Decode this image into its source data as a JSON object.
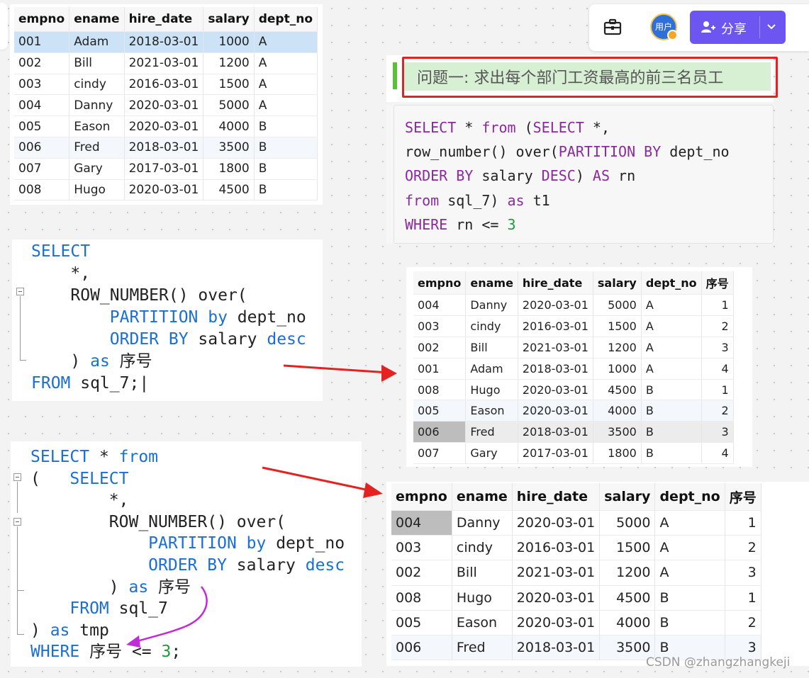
{
  "columns_base": [
    "empno",
    "ename",
    "hire_date",
    "salary",
    "dept_no"
  ],
  "columns_ranked": [
    "empno",
    "ename",
    "hire_date",
    "salary",
    "dept_no",
    "序号"
  ],
  "source_table": {
    "rows": [
      [
        "001",
        "Adam",
        "2018-03-01",
        "1000",
        "A"
      ],
      [
        "002",
        "Bill",
        "2021-03-01",
        "1200",
        "A"
      ],
      [
        "003",
        "cindy",
        "2016-03-01",
        "1500",
        "A"
      ],
      [
        "004",
        "Danny",
        "2020-03-01",
        "5000",
        "A"
      ],
      [
        "005",
        "Eason",
        "2020-03-01",
        "4000",
        "B"
      ],
      [
        "006",
        "Fred",
        "2018-03-01",
        "3500",
        "B"
      ],
      [
        "007",
        "Gary",
        "2017-03-01",
        "1800",
        "B"
      ],
      [
        "008",
        "Hugo",
        "2020-03-01",
        "4500",
        "B"
      ]
    ]
  },
  "ranked_table": {
    "rows": [
      [
        "004",
        "Danny",
        "2020-03-01",
        "5000",
        "A",
        "1"
      ],
      [
        "003",
        "cindy",
        "2016-03-01",
        "1500",
        "A",
        "2"
      ],
      [
        "002",
        "Bill",
        "2021-03-01",
        "1200",
        "A",
        "3"
      ],
      [
        "001",
        "Adam",
        "2018-03-01",
        "1000",
        "A",
        "4"
      ],
      [
        "008",
        "Hugo",
        "2020-03-01",
        "4500",
        "B",
        "1"
      ],
      [
        "005",
        "Eason",
        "2020-03-01",
        "4000",
        "B",
        "2"
      ],
      [
        "006",
        "Fred",
        "2018-03-01",
        "3500",
        "B",
        "3"
      ],
      [
        "007",
        "Gary",
        "2017-03-01",
        "1800",
        "B",
        "4"
      ]
    ]
  },
  "top3_table": {
    "rows": [
      [
        "004",
        "Danny",
        "2020-03-01",
        "5000",
        "A",
        "1"
      ],
      [
        "003",
        "cindy",
        "2016-03-01",
        "1500",
        "A",
        "2"
      ],
      [
        "002",
        "Bill",
        "2021-03-01",
        "1200",
        "A",
        "3"
      ],
      [
        "008",
        "Hugo",
        "2020-03-01",
        "4500",
        "B",
        "1"
      ],
      [
        "005",
        "Eason",
        "2020-03-01",
        "4000",
        "B",
        "2"
      ],
      [
        "006",
        "Fred",
        "2018-03-01",
        "3500",
        "B",
        "3"
      ]
    ]
  },
  "question": {
    "title": "问题一: 求出每个部门工资最高的前三名员工",
    "sql": {
      "l1_a": "SELECT",
      "l1_b": " * ",
      "l1_c": "from",
      "l1_d": " (",
      "l1_e": "SELECT",
      "l1_f": " *,",
      "l2_a": "row_number() over(",
      "l2_b": "PARTITION BY",
      "l2_c": " dept_no",
      "l3_a": "ORDER BY",
      "l3_b": " salary ",
      "l3_c": "DESC",
      "l3_d": ") ",
      "l3_e": "AS",
      "l3_f": " rn",
      "l4_a": "from",
      "l4_b": " sql_7) ",
      "l4_c": "as",
      "l4_d": " t1",
      "l5_a": "WHERE",
      "l5_b": " rn <= ",
      "l5_c": "3"
    }
  },
  "snippet1": {
    "select": "SELECT",
    "star": "*,",
    "rownum": "ROW_NUMBER() over(",
    "partition": "PARTITION by",
    "partition_col": " dept_no",
    "order": "ORDER BY",
    "order_col": " salary ",
    "desc": "desc",
    "close": ") ",
    "as": "as",
    "alias": " 序号",
    "from": "FROM",
    "from_tbl": " sql_7;"
  },
  "snippet2": {
    "select1": "SELECT",
    "star1": " * ",
    "from1": "from",
    "open": "(",
    "select2": "SELECT",
    "star2": "*,",
    "rownum": "ROW_NUMBER() over(",
    "partition": "PARTITION by",
    "partition_col": " dept_no",
    "order": "ORDER BY",
    "order_col": " salary ",
    "desc": "desc",
    "close": ") ",
    "as1": "as",
    "alias": " 序号",
    "from2": "FROM",
    "from_tbl": " sql_7",
    "close2": ") ",
    "as2": "as",
    "tmp": " tmp",
    "where": "WHERE",
    "cond": " 序号 <= ",
    "three": "3",
    "semi": ";"
  },
  "toolbar": {
    "avatar_label": "用户",
    "share_label": "分享"
  },
  "watermark": "CSDN @zhangzhangkeji",
  "colors": {
    "keyword": "#1a6fd6",
    "sql_keyword": "#8a2a9c",
    "number": "#1f9a3b",
    "share_button": "#6c55f0",
    "annotation_red": "#e52222",
    "annotation_purple": "#c22bd8",
    "question_banner": "#d7efd3"
  }
}
